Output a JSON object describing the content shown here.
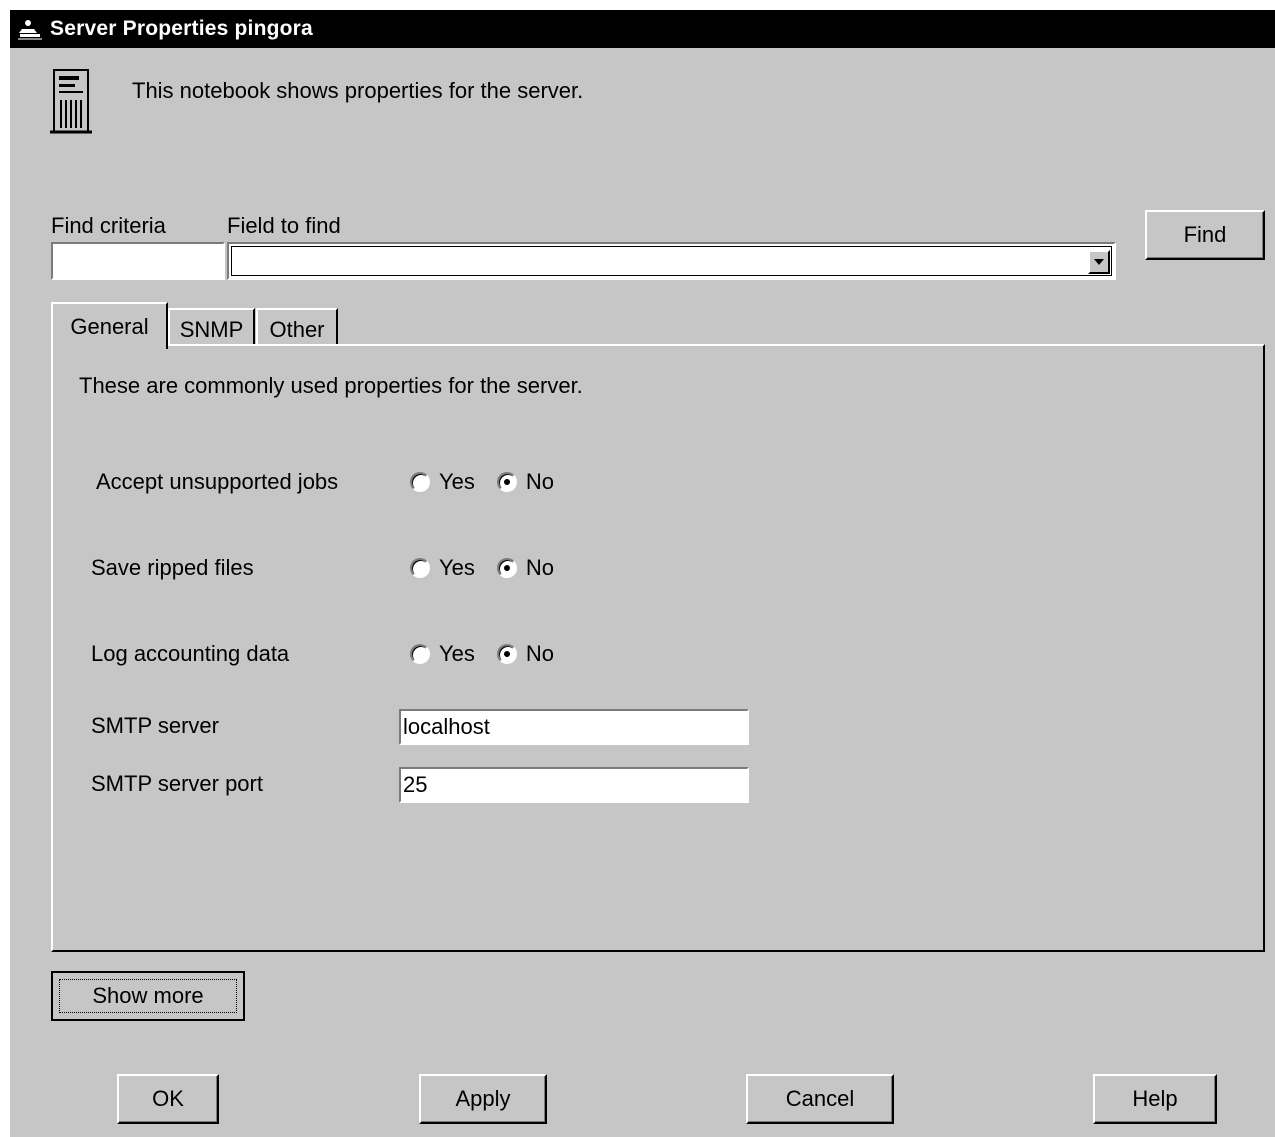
{
  "window": {
    "title": "Server Properties pingora",
    "title_icon": "server-app-icon"
  },
  "header": {
    "icon": "server-tower-icon",
    "description": "This notebook shows properties for the server."
  },
  "find": {
    "criteria_label": "Find criteria",
    "criteria_value": "",
    "field_label": "Field to find",
    "field_value": "",
    "button_label": "Find"
  },
  "tabs": [
    {
      "label": "General",
      "selected": true
    },
    {
      "label": "SNMP",
      "selected": false
    },
    {
      "label": "Other",
      "selected": false
    }
  ],
  "general": {
    "description": "These are commonly used properties for the server.",
    "rows": [
      {
        "label": "Accept unsupported jobs",
        "options": [
          "Yes",
          "No"
        ],
        "selected": "No"
      },
      {
        "label": "Save ripped files",
        "options": [
          "Yes",
          "No"
        ],
        "selected": "No"
      },
      {
        "label": "Log accounting data",
        "options": [
          "Yes",
          "No"
        ],
        "selected": "No"
      }
    ],
    "smtp_server_label": "SMTP server",
    "smtp_server_value": "localhost",
    "smtp_port_label": "SMTP server port",
    "smtp_port_value": "25"
  },
  "buttons": {
    "show_more": "Show more",
    "ok": "OK",
    "apply": "Apply",
    "cancel": "Cancel",
    "help": "Help"
  }
}
